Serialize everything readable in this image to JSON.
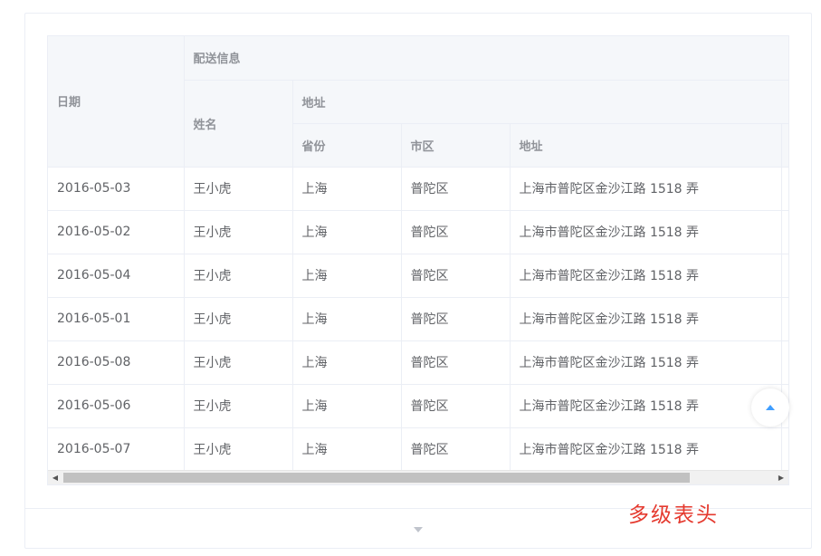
{
  "table": {
    "headers": {
      "date": "日期",
      "delivery_info": "配送信息",
      "name": "姓名",
      "address_group": "地址",
      "province": "省份",
      "city": "市区",
      "address": "地址"
    },
    "rows": [
      {
        "date": "2016-05-03",
        "name": "王小虎",
        "province": "上海",
        "city": "普陀区",
        "address": "上海市普陀区金沙江路 1518 弄"
      },
      {
        "date": "2016-05-02",
        "name": "王小虎",
        "province": "上海",
        "city": "普陀区",
        "address": "上海市普陀区金沙江路 1518 弄"
      },
      {
        "date": "2016-05-04",
        "name": "王小虎",
        "province": "上海",
        "city": "普陀区",
        "address": "上海市普陀区金沙江路 1518 弄"
      },
      {
        "date": "2016-05-01",
        "name": "王小虎",
        "province": "上海",
        "city": "普陀区",
        "address": "上海市普陀区金沙江路 1518 弄"
      },
      {
        "date": "2016-05-08",
        "name": "王小虎",
        "province": "上海",
        "city": "普陀区",
        "address": "上海市普陀区金沙江路 1518 弄"
      },
      {
        "date": "2016-05-06",
        "name": "王小虎",
        "province": "上海",
        "city": "普陀区",
        "address": "上海市普陀区金沙江路 1518 弄"
      },
      {
        "date": "2016-05-07",
        "name": "王小虎",
        "province": "上海",
        "city": "普陀区",
        "address": "上海市普陀区金沙江路 1518 弄"
      }
    ]
  },
  "caption": "多级表头",
  "colors": {
    "header_bg": "#f5f7fa",
    "border": "#ebeef5",
    "accent": "#409eff",
    "caption": "#e53a2f"
  },
  "icons": {
    "back_to_top": "caret-up-icon",
    "expand": "caret-down-icon",
    "scroll_left": "scroll-left-arrow-icon",
    "scroll_right": "scroll-right-arrow-icon"
  }
}
